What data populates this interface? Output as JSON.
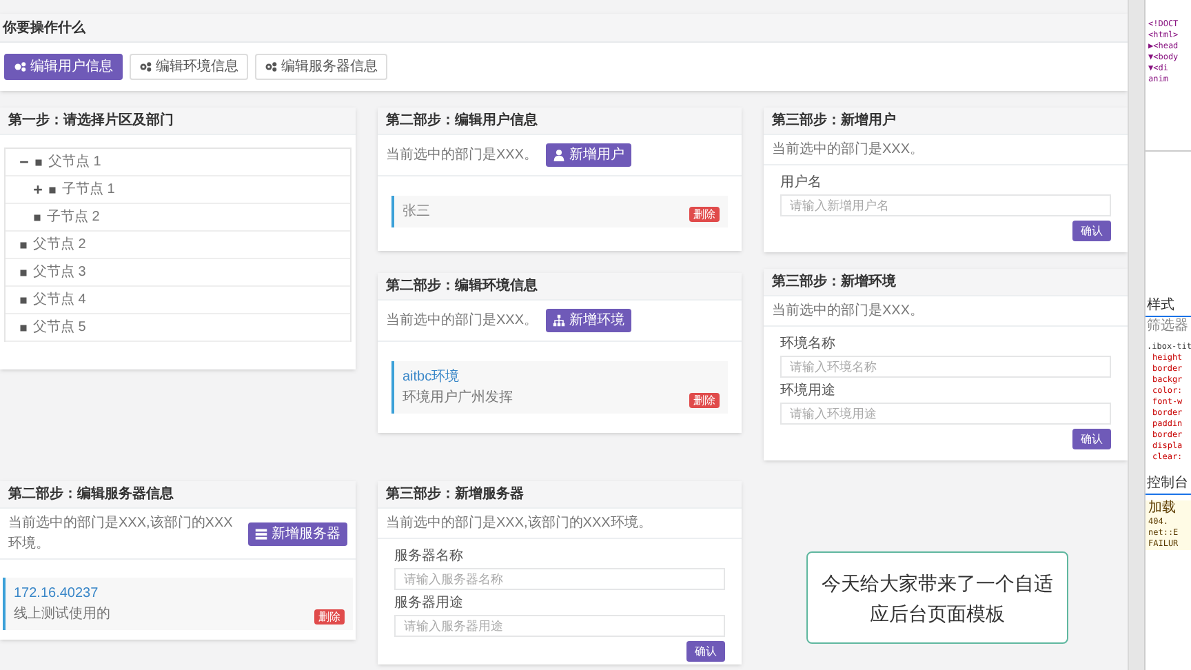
{
  "top_panel": {
    "title": "你要操作什么",
    "buttons": [
      {
        "label": "编辑用户信息",
        "selected": true
      },
      {
        "label": "编辑环境信息",
        "selected": false
      },
      {
        "label": "编辑服务器信息",
        "selected": false
      }
    ]
  },
  "tree_card": {
    "title": "第一步：请选择片区及部门",
    "nodes": [
      {
        "label": "父节点 1",
        "expanded": true,
        "children": [
          {
            "label": "子节点 1",
            "expanded": false
          },
          {
            "label": "子节点 2"
          }
        ]
      },
      {
        "label": "父节点 2"
      },
      {
        "label": "父节点 3"
      },
      {
        "label": "父节点 4"
      },
      {
        "label": "父节点 5"
      }
    ]
  },
  "user_card": {
    "title": "第二部步：编辑用户信息",
    "info": "当前选中的部门是XXX。",
    "add_button": "新增用户",
    "items": [
      {
        "name": "张三",
        "delete": "删除"
      }
    ]
  },
  "env_card": {
    "title": "第二部步：编辑环境信息",
    "info": "当前选中的部门是XXX。",
    "add_button": "新增环境",
    "items": [
      {
        "name": "aitbc环境",
        "note": "环境用户广州发挥",
        "delete": "删除"
      }
    ]
  },
  "new_user_card": {
    "title": "第三部步：新增用户",
    "info": "当前选中的部门是XXX。",
    "fields": [
      {
        "label": "用户名",
        "placeholder": "请输入新增用户名"
      }
    ],
    "confirm": "确认"
  },
  "new_env_card": {
    "title": "第三部步：新增环境",
    "info": "当前选中的部门是XXX。",
    "fields": [
      {
        "label": "环境名称",
        "placeholder": "请输入环境名称"
      },
      {
        "label": "环境用途",
        "placeholder": "请输入环境用途"
      }
    ],
    "confirm": "确认"
  },
  "server_card": {
    "title": "第二部步：编辑服务器信息",
    "info": "当前选中的部门是XXX,该部门的XXX环境。",
    "add_button": "新增服务器",
    "items": [
      {
        "name": "172.16.40237",
        "note": "线上测试使用的",
        "delete": "删除"
      }
    ]
  },
  "new_server_card": {
    "title": "第三部步：新增服务器",
    "info": "当前选中的部门是XXX,该部门的XXX环境。",
    "fields": [
      {
        "label": "服务器名称",
        "placeholder": "请输入服务器名称"
      },
      {
        "label": "服务器用途",
        "placeholder": "请输入服务器用途"
      }
    ],
    "confirm": "确认"
  },
  "caption": "今天给大家带来了一个自适应后台页面模板",
  "devtools": {
    "elements": [
      "<!DOCT",
      "<html>",
      "▶<head",
      "▼<body",
      "▼<di",
      "anim"
    ],
    "tab": "样式",
    "filter": "筛选器",
    "rule_selector": ".ibox-tit",
    "properties": [
      "height",
      "border",
      "backgr",
      "color:",
      "font-w",
      "border",
      "paddin",
      "border",
      "displa",
      "clear:"
    ],
    "console_tab": "控制台",
    "console_lines": [
      "加载",
      "404.",
      "net::E",
      "FAILUR"
    ]
  }
}
